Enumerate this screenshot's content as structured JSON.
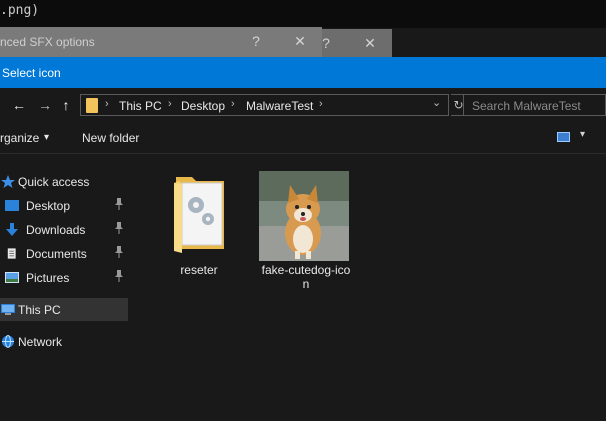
{
  "terminal": {
    "text": ".png)"
  },
  "background_dialogs": [
    {
      "title": "nced SFX options",
      "help": "?",
      "close": "✕"
    },
    {
      "help": "?",
      "close": "✕"
    }
  ],
  "dialog": {
    "title": "Select icon",
    "nav": {
      "back": "←",
      "forward": "→",
      "up": "↑"
    },
    "breadcrumb": [
      "This PC",
      "Desktop",
      "MalwareTest"
    ],
    "breadcrumb_sep": "›",
    "breadcrumb_dropdown": "⌄",
    "refresh": "↻",
    "search_placeholder": "Search MalwareTest",
    "toolbar": {
      "organize": "rganize",
      "organize_arrow": "▾",
      "new_folder": "New folder",
      "view_arrow": "▾"
    },
    "sidebar": {
      "quick_access": "Quick access",
      "items": [
        {
          "label": "Desktop",
          "pinned": true
        },
        {
          "label": "Downloads",
          "pinned": true
        },
        {
          "label": "Documents",
          "pinned": true
        },
        {
          "label": "Pictures",
          "pinned": true
        }
      ],
      "pin_glyph": "📌",
      "this_pc": "This PC",
      "network": "Network"
    },
    "files": [
      {
        "name": "reseter",
        "type": "folder"
      },
      {
        "name": "fake-cutedog-ico",
        "name_line2": "n",
        "type": "image"
      }
    ]
  },
  "colors": {
    "accent": "#0078d7",
    "folder": "#f4c45c",
    "background": "#191919",
    "selected": "#333333"
  }
}
